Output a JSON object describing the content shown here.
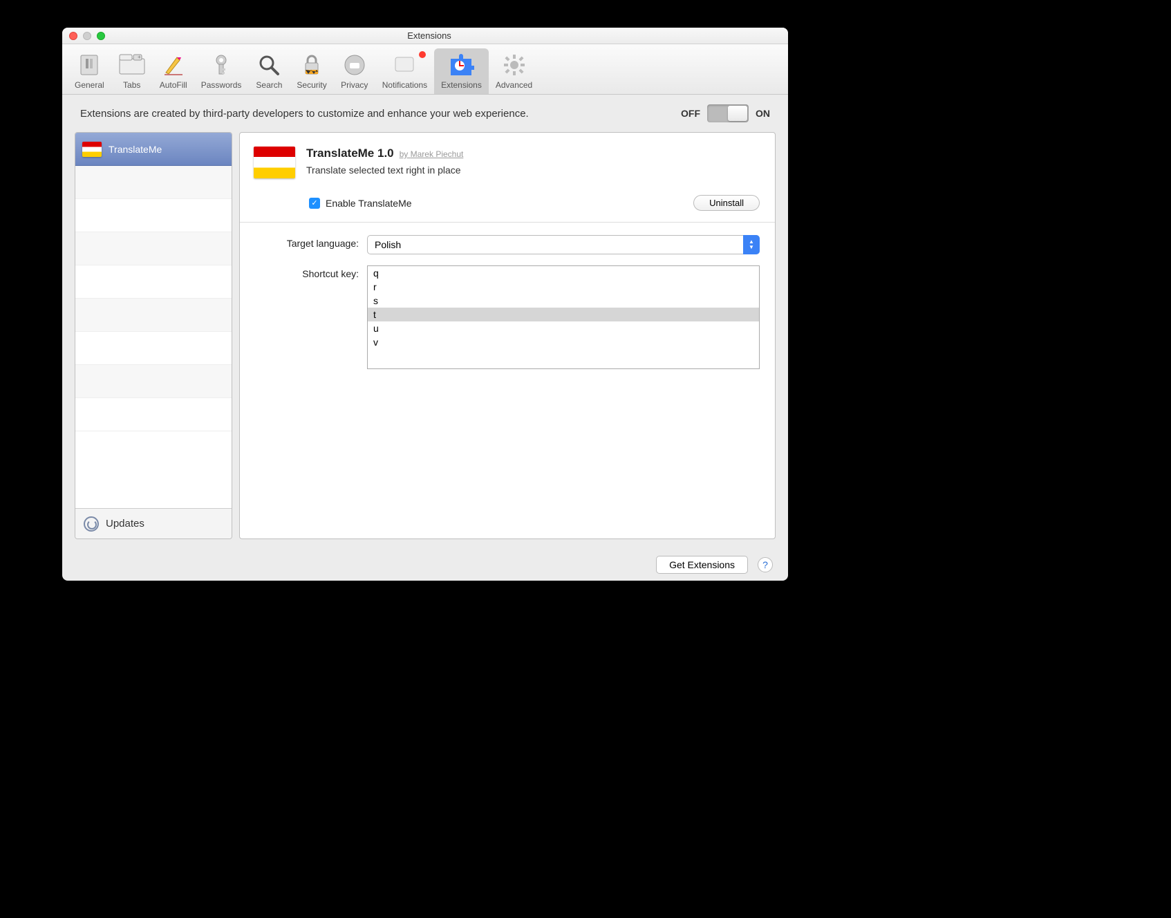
{
  "window": {
    "title": "Extensions"
  },
  "toolbar": {
    "items": [
      {
        "label": "General"
      },
      {
        "label": "Tabs"
      },
      {
        "label": "AutoFill"
      },
      {
        "label": "Passwords"
      },
      {
        "label": "Search"
      },
      {
        "label": "Security"
      },
      {
        "label": "Privacy"
      },
      {
        "label": "Notifications",
        "badge": true
      },
      {
        "label": "Extensions",
        "active": true
      },
      {
        "label": "Advanced"
      }
    ]
  },
  "header": {
    "description": "Extensions are created by third-party developers to customize and enhance your web experience.",
    "toggle": {
      "off_label": "OFF",
      "on_label": "ON",
      "state": "on"
    }
  },
  "sidebar": {
    "items": [
      {
        "label": "TranslateMe",
        "selected": true
      }
    ],
    "updates_label": "Updates"
  },
  "detail": {
    "title": "TranslateMe 1.0",
    "author_prefix": "by ",
    "author": "Marek Piechut",
    "description": "Translate selected text right in place",
    "enable_label": "Enable TranslateMe",
    "enable_checked": true,
    "uninstall_label": "Uninstall",
    "settings": {
      "target_language": {
        "label": "Target language:",
        "value": "Polish"
      },
      "shortcut_key": {
        "label": "Shortcut key:",
        "options": [
          "q",
          "r",
          "s",
          "t",
          "u",
          "v"
        ],
        "selected": "t"
      }
    }
  },
  "footer": {
    "get_extensions_label": "Get Extensions",
    "help_label": "?"
  }
}
